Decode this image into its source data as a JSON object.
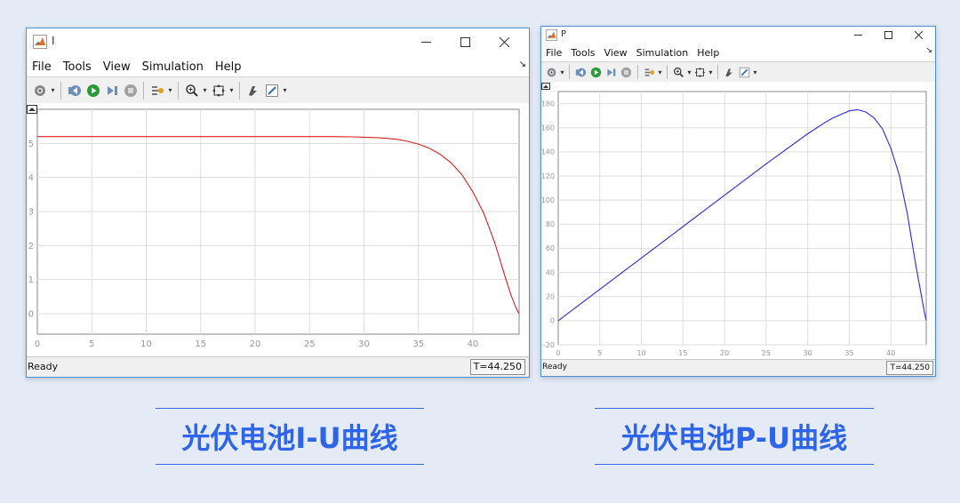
{
  "windows": [
    {
      "id": "I",
      "title": "I",
      "menu": [
        "File",
        "Tools",
        "View",
        "Simulation",
        "Help"
      ],
      "status": "Ready",
      "time": "T=44.250"
    },
    {
      "id": "P",
      "title": "P",
      "menu": [
        "File",
        "Tools",
        "View",
        "Simulation",
        "Help"
      ],
      "status": "Ready",
      "time": "T=44.250"
    }
  ],
  "captions": [
    "光伏电池I-U曲线",
    "光伏电池P-U曲线"
  ],
  "colors": {
    "background": "#e4ebf7",
    "window_border": "#4a90d9",
    "caption": "#2d64e8",
    "curve_I": "#d92020",
    "curve_P": "#2a2ae0",
    "grid": "#dedede",
    "tick_text": "#999999"
  },
  "icons": {
    "window": [
      "matlab-logo-icon",
      "minimize-icon",
      "maximize-icon",
      "close-icon"
    ],
    "toolbar": [
      "settings-icon",
      "step-back-icon",
      "run-icon",
      "step-forward-icon",
      "stop-icon",
      "signal-icon",
      "zoom-in-icon",
      "fit-view-icon",
      "highlight-icon",
      "edit-icon"
    ]
  },
  "chart_data": [
    {
      "type": "line",
      "title": "",
      "xlabel": "",
      "ylabel": "",
      "xlim": [
        0,
        44.25
      ],
      "ylim": [
        -0.6,
        6.0
      ],
      "xticks": [
        0,
        5,
        10,
        15,
        20,
        25,
        30,
        35,
        40
      ],
      "yticks": [
        0,
        1,
        2,
        3,
        4,
        5
      ],
      "grid": true,
      "series": [
        {
          "color": "#d92020",
          "x": [
            0,
            5,
            10,
            15,
            20,
            25,
            27,
            29,
            30,
            31,
            32,
            33,
            34,
            35,
            36,
            37,
            38,
            39,
            40,
            41,
            42,
            43,
            43.5,
            44,
            44.25
          ],
          "y": [
            5.2,
            5.2,
            5.2,
            5.2,
            5.2,
            5.2,
            5.2,
            5.19,
            5.18,
            5.17,
            5.15,
            5.12,
            5.06,
            4.98,
            4.86,
            4.68,
            4.43,
            4.08,
            3.58,
            2.95,
            2.1,
            1.05,
            0.55,
            0.15,
            0
          ]
        }
      ]
    },
    {
      "type": "line",
      "title": "",
      "xlabel": "",
      "ylabel": "",
      "xlim": [
        0,
        44.25
      ],
      "ylim": [
        -20,
        190
      ],
      "xticks": [
        0,
        5,
        10,
        15,
        20,
        25,
        30,
        35,
        40
      ],
      "yticks": [
        -20,
        0,
        20,
        40,
        60,
        80,
        100,
        120,
        140,
        160,
        180
      ],
      "grid": true,
      "series": [
        {
          "color": "#2a2ae0",
          "x": [
            0,
            5,
            10,
            15,
            20,
            25,
            30,
            32,
            33,
            34,
            35,
            36,
            37,
            38,
            39,
            40,
            41,
            42,
            43,
            44,
            44.25
          ],
          "y": [
            0,
            26,
            52,
            78,
            104,
            130,
            155,
            164,
            168,
            171,
            174,
            175,
            173,
            168,
            159,
            143,
            121,
            88,
            46,
            8,
            0
          ]
        }
      ]
    }
  ]
}
